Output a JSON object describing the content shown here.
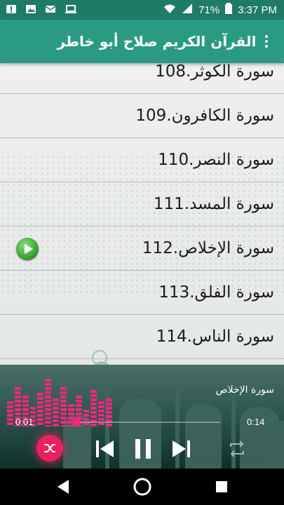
{
  "status_bar": {
    "battery": "71%",
    "time": "3:37 PM",
    "left_icons": [
      "alert-icon",
      "image-icon",
      "email-icon",
      "laptop-icon"
    ]
  },
  "app": {
    "title": "القرآن الكريم صلاح أبو خاطر"
  },
  "surahs": [
    {
      "label": "108.سورة الكوثر",
      "playing": false
    },
    {
      "label": "109.سورة الكافرون",
      "playing": false
    },
    {
      "label": "110.سورة النصر",
      "playing": false
    },
    {
      "label": "111.سورة المسد",
      "playing": false
    },
    {
      "label": "112.سورة الإخلاص",
      "playing": true
    },
    {
      "label": "113.سورة الفلق",
      "playing": false
    },
    {
      "label": "114.سورة الناس",
      "playing": false
    }
  ],
  "player": {
    "track_title": "سورة الإخلاص",
    "elapsed": "0:01",
    "duration": "0:14",
    "progress": 0.07,
    "equalizer_levels": [
      0.45,
      0.7,
      0.55,
      0.35,
      0.6,
      0.85,
      0.5,
      0.7,
      0.4,
      0.55,
      0.3,
      0.65,
      0.45,
      0.5
    ]
  },
  "colors": {
    "status_bar": "#1f7a66",
    "app_bar": "#2a9b82",
    "accent": "#f2277d",
    "play_button": "#2e9a2b"
  }
}
